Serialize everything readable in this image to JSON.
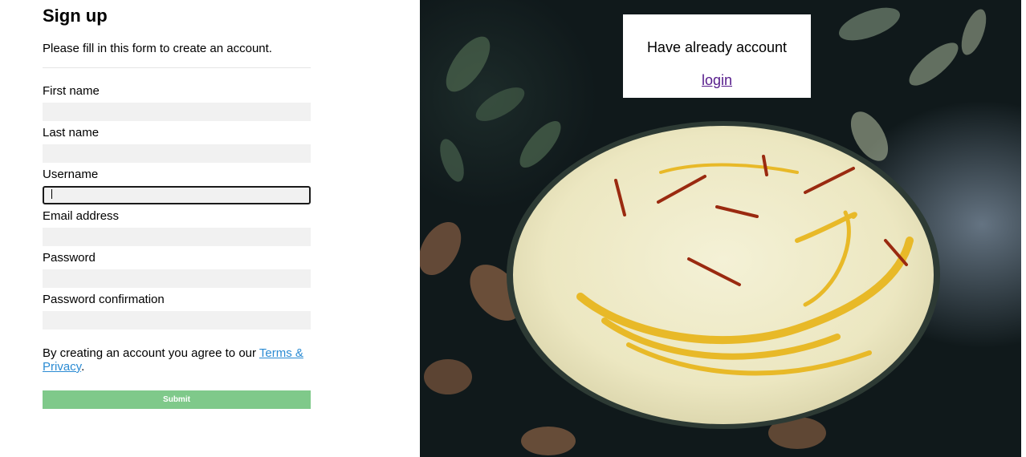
{
  "form": {
    "title": "Sign up",
    "subtitle": "Please fill in this form to create an account.",
    "fields": [
      {
        "label": "First name",
        "value": "",
        "focused": false
      },
      {
        "label": "Last name",
        "value": "",
        "focused": false
      },
      {
        "label": "Username",
        "value": "",
        "focused": true
      },
      {
        "label": "Email address",
        "value": "",
        "focused": false
      },
      {
        "label": "Password",
        "value": "",
        "focused": false
      },
      {
        "label": "Password confirmation",
        "value": "",
        "focused": false
      }
    ],
    "terms_prefix": "By creating an account you agree to our ",
    "terms_link": "Terms & Privacy",
    "terms_suffix": ".",
    "submit_label": "Submit"
  },
  "side": {
    "prompt": "Have already account",
    "login_link": "login"
  }
}
